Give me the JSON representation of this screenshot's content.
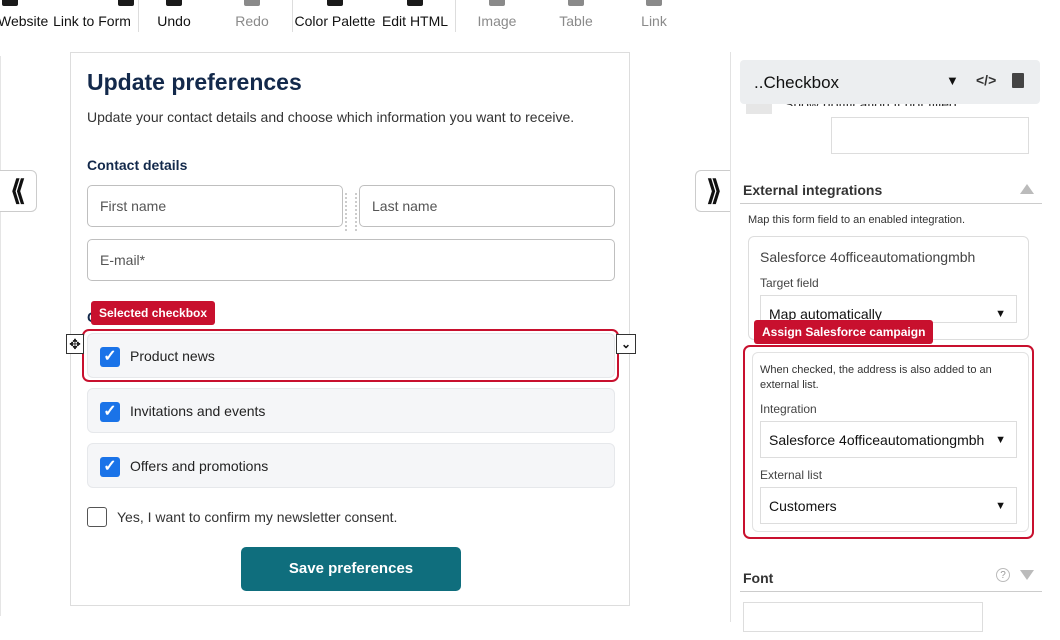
{
  "toolbar": {
    "items": [
      {
        "label": "Website",
        "disabled": false
      },
      {
        "label": "Link to Form",
        "disabled": false
      },
      {
        "label": "Undo",
        "disabled": false
      },
      {
        "label": "Redo",
        "disabled": true
      },
      {
        "label": "Color Palette",
        "disabled": false
      },
      {
        "label": "Edit HTML",
        "disabled": false
      },
      {
        "label": "Image",
        "disabled": true
      },
      {
        "label": "Table",
        "disabled": true
      },
      {
        "label": "Link",
        "disabled": true
      }
    ]
  },
  "nav": {
    "collapse_left": "⟪",
    "collapse_right": "⟫"
  },
  "form": {
    "title": "Update preferences",
    "description": "Update your contact details and choose which information you want to receive.",
    "contact_section": "Contact details",
    "first_name_placeholder": "First name",
    "last_name_placeholder": "Last name",
    "email_placeholder": "E-mail*",
    "hidden_section_initial": "C",
    "checkboxes": [
      {
        "label": "Product news",
        "checked": true
      },
      {
        "label": "Invitations and events",
        "checked": true
      },
      {
        "label": "Offers and promotions",
        "checked": true
      }
    ],
    "consent_label": "Yes, I want to confirm my newsletter consent.",
    "save_button": "Save preferences"
  },
  "annotations": {
    "selected_checkbox": "Selected checkbox",
    "assign_campaign": "Assign Salesforce campaign"
  },
  "panel": {
    "header_title": "..Checkbox",
    "partial_row": "Show notification if not filled.",
    "external_integrations": {
      "label": "External integrations",
      "description": "Map this form field to an enabled integration.",
      "integration_name": "Salesforce 4officeautomationgmbh",
      "target_field_label": "Target field",
      "target_field_value": "Map automatically"
    },
    "campaign": {
      "description": "When checked, the address is also added to an external list.",
      "integration_label": "Integration",
      "integration_value": "Salesforce 4officeautomationgmbh",
      "external_list_label": "External list",
      "external_list_value": "Customers"
    },
    "font_label": "Font"
  },
  "colors": {
    "accent_red": "#c8102e",
    "save_button": "#0f6e7d",
    "checkbox_blue": "#1a73e8",
    "title_navy": "#13294b"
  },
  "icons": [
    "code-icon",
    "trash-icon",
    "move-icon",
    "chevron-down-icon",
    "help-icon"
  ]
}
